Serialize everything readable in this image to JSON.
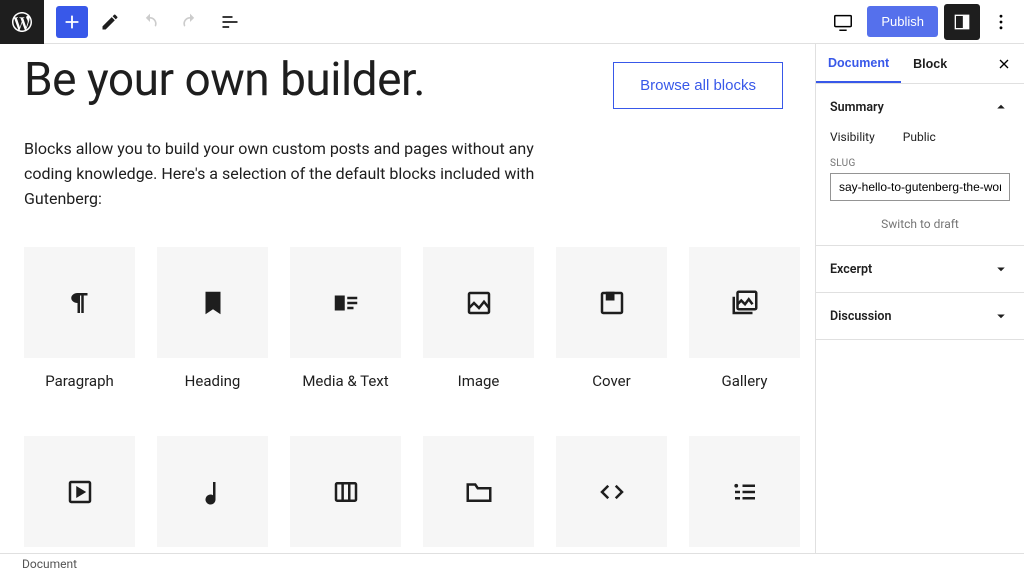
{
  "toolbar": {
    "publish_label": "Publish"
  },
  "hero": {
    "title": "Be your own builder.",
    "browse_label": "Browse all blocks"
  },
  "intro_text": "Blocks allow you to build your own custom posts and pages without any coding knowledge. Here's a selection of the default blocks included with Gutenberg:",
  "blocks": {
    "b0": "Paragraph",
    "b1": "Heading",
    "b2": "Media & Text",
    "b3": "Image",
    "b4": "Cover",
    "b5": "Gallery"
  },
  "sidebar": {
    "tab_document": "Document",
    "tab_block": "Block",
    "summary": {
      "title": "Summary",
      "visibility_label": "Visibility",
      "visibility_value": "Public",
      "slug_label": "Slug",
      "slug_value": "say-hello-to-gutenberg-the-wordpress-ed",
      "draft_label": "Switch to draft"
    },
    "excerpt_title": "Excerpt",
    "discussion_title": "Discussion"
  },
  "footer_breadcrumb": "Document"
}
